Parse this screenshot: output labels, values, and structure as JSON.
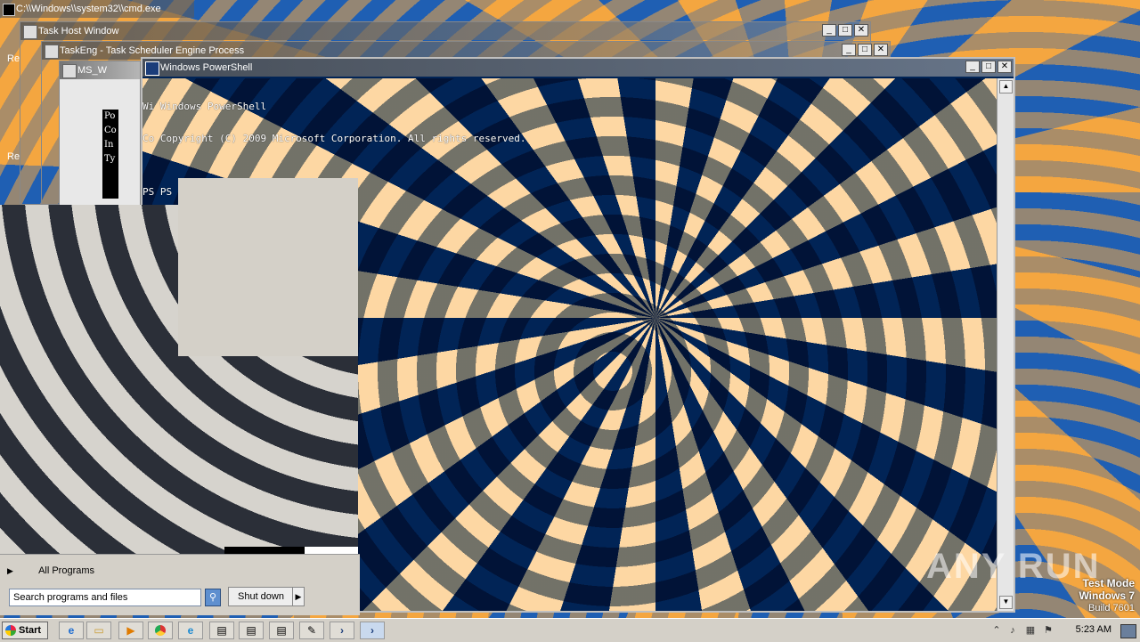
{
  "windows": {
    "cmd": {
      "title": "C:\\\\Windows\\\\system32\\\\cmd.exe"
    },
    "taskhost": {
      "title": "Task Host Window"
    },
    "taskeng": {
      "title": "TaskEng - Task Scheduler Engine Process"
    },
    "msw": {
      "title": "MS_W"
    },
    "powershell": {
      "title": "Windows PowerShell",
      "console_lines": [
        "Wi Windows PowerShell",
        "Co Copyright (C) 2009 Microsoft Corporation. All rights reserved.",
        "",
        "PS PS C:\\Users\\admin>"
      ]
    },
    "side_text": {
      "l1": "Po",
      "l2": "Co",
      "l3": "In",
      "l4": "Ty"
    }
  },
  "start_menu": {
    "all_programs": "All Programs",
    "search_placeholder": "Search programs and files",
    "shutdown": "Shut down"
  },
  "taskbar": {
    "start": "Start",
    "clock": "5:23 AM",
    "items": [
      "ie-icon",
      "explorer-icon",
      "media-player-icon",
      "chrome-icon",
      "edge-icon",
      "window-icon",
      "window-icon",
      "window-icon",
      "notepad-icon",
      "powershell-icon",
      "powershell-icon"
    ]
  },
  "overlay": {
    "test_mode_line1": "Test Mode",
    "test_mode_line2": "Windows 7",
    "test_mode_line3": "Build 7601",
    "watermark": "ANY RUN"
  },
  "desktop_icons": {
    "a": "Re",
    "b": "Re"
  },
  "colors": {
    "ps_bg": "#012456",
    "ps_fg": "#fdd7a3",
    "desktop_orange": "#f4a640",
    "desktop_blue": "#1f5fb3"
  }
}
